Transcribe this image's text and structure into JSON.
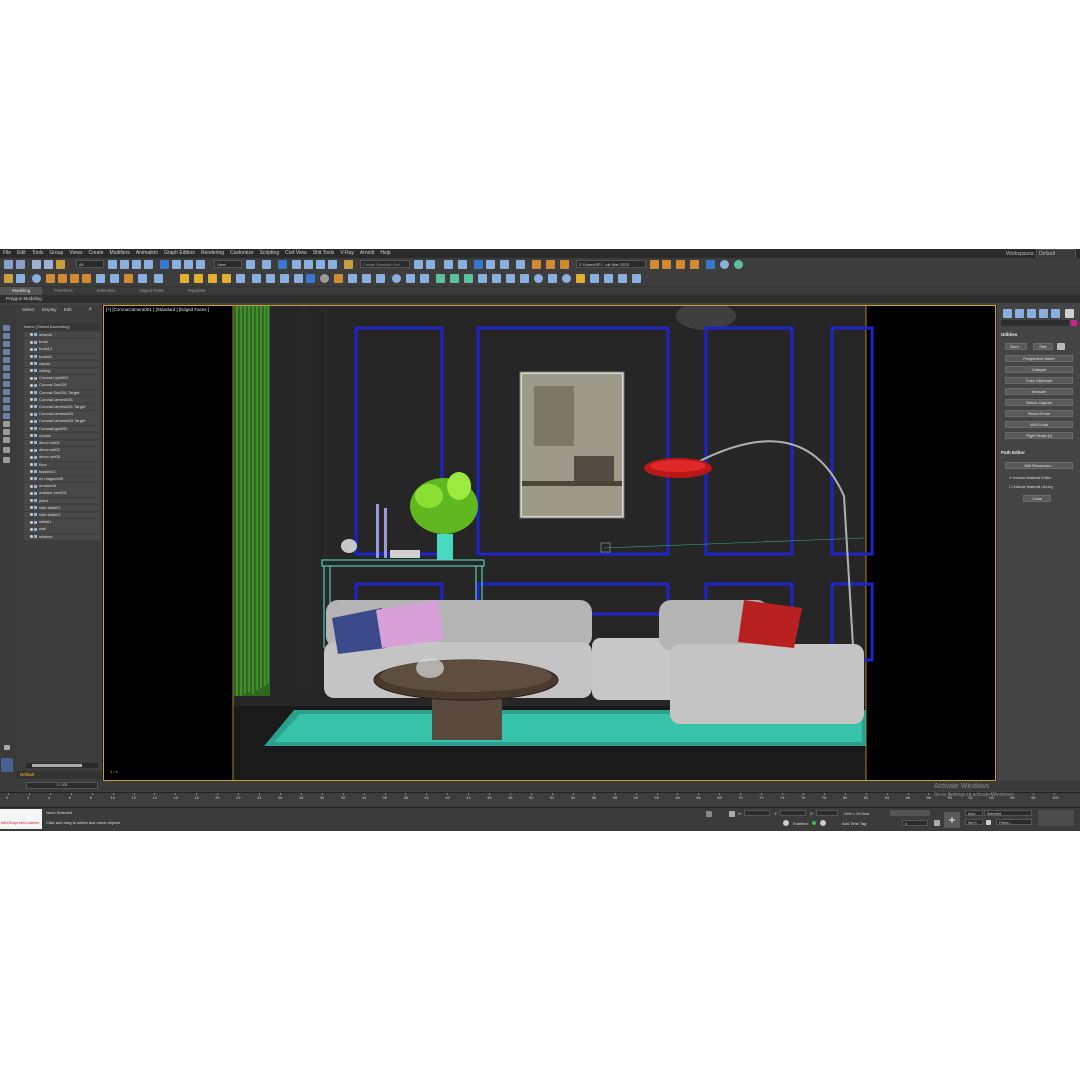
{
  "menu": [
    "File",
    "Edit",
    "Tools",
    "Group",
    "Views",
    "Create",
    "Modifiers",
    "Animation",
    "Graph Editors",
    "Rendering",
    "Customize",
    "Scripting",
    "Civil View",
    "Shit Tools",
    "V-Ray",
    "Arnold",
    "Help"
  ],
  "workspace": {
    "label": "Workspaces:",
    "value": "Default"
  },
  "toolbar": {
    "filter_value": "All",
    "view_value": "View",
    "selection_set_placeholder": "Create Selection Set",
    "project_path": "C:\\Users\\SFI...\\de Mar 2023"
  },
  "ribbon": {
    "tabs": [
      "Modeling",
      "Freeform",
      "Selection",
      "Object Paint",
      "Populate"
    ],
    "active": "Modeling",
    "sub": "Polygon Modeling"
  },
  "explorer": {
    "tabs": [
      "Select",
      "Display",
      "Edit"
    ],
    "column": "Name (Sorted Ascending)",
    "items": [
      "artwork",
      "book",
      "book13",
      "bookd1",
      "carpet",
      "ceiling",
      "Corona Light001",
      "Corona Sun001",
      "Corona Sun001.Target",
      "CoronaCamera001",
      "CoronaCamera001.Target",
      "CoronaCamera003",
      "CoronaCamera003.Target",
      "CoronaLight002",
      "curtain",
      "decor set01",
      "decor set02",
      "decor set05",
      "floor",
      "blaster22",
      "ev magoon49",
      "ornament",
      "outdoor env001",
      "plant",
      "side table01",
      "side table01",
      "stellal1",
      "wall",
      "window"
    ],
    "layer": "Default"
  },
  "viewport": {
    "label": "[+] [CoronaCamera001 ] [Standard ] [Edged Faces ]",
    "corner_info": "4 / 4"
  },
  "command_panel": {
    "section_utilities": "Utilities",
    "more": "More...",
    "sets": "Sets",
    "buttons": [
      "Perspective Match",
      "Collapse",
      "Color Clipboard",
      "Measure",
      "Motion Capture",
      "Reset XForm",
      "MAXScript",
      "Flight Studio (c)"
    ],
    "section_path": "Path Editor",
    "edit_resources": "Edit Resources...",
    "include_material_editor": "Include Material Editor",
    "include_material_library": "Include Material Library",
    "close": "Close"
  },
  "timeline": {
    "slider": "0 / 100",
    "ticks": [
      "0",
      "2",
      "4",
      "6",
      "8",
      "10",
      "12",
      "14",
      "16",
      "18",
      "20",
      "22",
      "24",
      "26",
      "28",
      "30",
      "32",
      "34",
      "36",
      "38",
      "40",
      "42",
      "44",
      "46",
      "48",
      "50",
      "52",
      "54",
      "56",
      "58",
      "60",
      "62",
      "64",
      "66",
      "68",
      "70",
      "72",
      "74",
      "76",
      "78",
      "80",
      "82",
      "84",
      "86",
      "88",
      "90",
      "92",
      "94",
      "96",
      "98",
      "100"
    ]
  },
  "status": {
    "maxscript": "MAXScript Mini Listener",
    "selection": "None Selected",
    "prompt": "Click and drag to select and move objects",
    "x_label": "X:",
    "y_label": "Y:",
    "z_label": "Z:",
    "grid": "Grid = 10.0cm",
    "enabled": "Enabled:",
    "add_time_tag": "Add Time Tag",
    "auto": "Auto",
    "set_k": "Set K.",
    "selected": "Selected",
    "filters": "Filters...",
    "frame": "0"
  },
  "watermark": {
    "title": "Activate Windows",
    "sub": "Go to Settings to activate Windows."
  }
}
